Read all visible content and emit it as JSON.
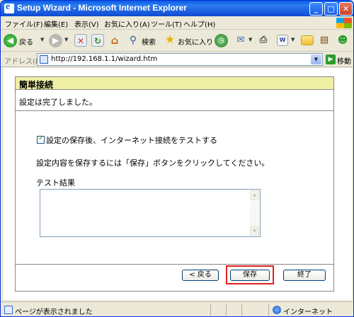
{
  "window": {
    "title": "Setup Wizard - Microsoft Internet Explorer",
    "controls": {
      "minimize": "_",
      "maximize": "□",
      "close": "✕"
    }
  },
  "menubar": {
    "items": [
      "ファイル(F)",
      "編集(E)",
      "表示(V)",
      "お気に入り(A)",
      "ツール(T)",
      "ヘルプ(H)"
    ]
  },
  "toolbar": {
    "back_label": "戻る",
    "search_label": "検索",
    "favorites_label": "お気に入り"
  },
  "address": {
    "label": "アドレス(D)",
    "url": "http://192.168.1.1/wizard.htm",
    "go_label": "移動"
  },
  "wizard": {
    "header": "簡単接続",
    "status": "設定は完了しました。",
    "checkbox_label": "設定の保存後、インターネット接続をテストする",
    "checkbox_checked": true,
    "instruction": "設定内容を保存するには「保存」ボタンをクリックしてください。",
    "result_label": "テスト結果",
    "result_value": "",
    "buttons": {
      "back": "< 戻る",
      "save": "保存",
      "finish": "終了"
    },
    "highlight_color": "#e0201f",
    "header_color": "#f0f0a4"
  },
  "statusbar": {
    "text": "ページが表示されました",
    "zone": "インターネット"
  },
  "icons": [
    "ie-icon",
    "back-icon",
    "forward-icon",
    "stop-icon",
    "refresh-icon",
    "home-icon",
    "search-icon",
    "favorites-star-icon",
    "history-icon",
    "mail-icon",
    "print-icon",
    "edit-icon",
    "folder-icon",
    "messenger-icon",
    "windows-flag-icon",
    "page-icon",
    "go-icon",
    "globe-icon"
  ]
}
